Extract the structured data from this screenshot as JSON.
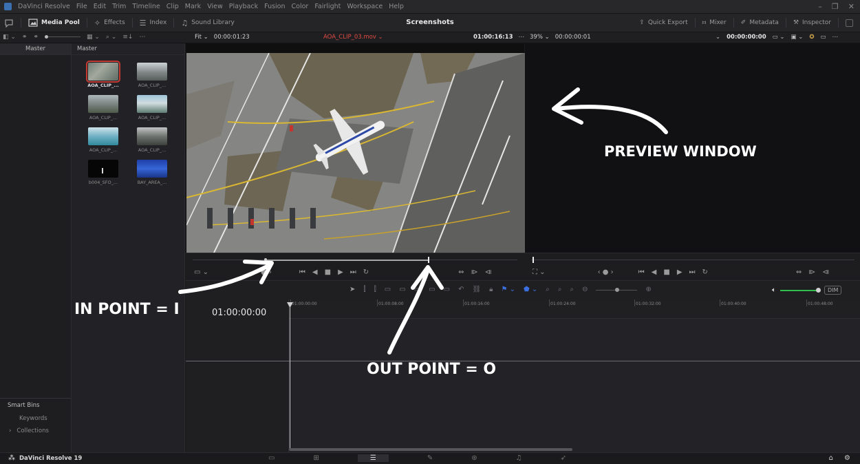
{
  "menubar": {
    "items": [
      "DaVinci Resolve",
      "File",
      "Edit",
      "Trim",
      "Timeline",
      "Clip",
      "Mark",
      "View",
      "Playback",
      "Fusion",
      "Color",
      "Fairlight",
      "Workspace",
      "Help"
    ]
  },
  "toolbar": {
    "media_pool": "Media Pool",
    "effects": "Effects",
    "index": "Index",
    "sound_library": "Sound Library",
    "project_title": "Screenshots",
    "quick_export": "Quick Export",
    "mixer": "Mixer",
    "metadata": "Metadata",
    "inspector": "Inspector"
  },
  "subbar": {
    "fit": "Fit",
    "src_duration": "00:00:01:23",
    "clip_name": "AOA_CLIP_03.mov",
    "src_timecode": "01:00:16:13",
    "zoom": "39%",
    "tl_duration": "00:00:00:01",
    "tl_timecode": "00:00:00:00"
  },
  "bins": {
    "header": "Master",
    "smart_bins": "Smart Bins",
    "keywords": "Keywords",
    "collections": "Collections"
  },
  "media": {
    "header": "Master",
    "clips": [
      "AOA_CLIP_...",
      "AOA_CLIP_...",
      "AOA_CLIP_...",
      "AOA_CLIP_...",
      "AOA_CLIP_...",
      "AOA_CLIP_...",
      "b004_SFO_...",
      "BAY_AREA_..."
    ]
  },
  "timeline": {
    "timecode": "01:00:00:00",
    "ticks": [
      "01:00:00:00",
      "01:00:08:00",
      "01:00:16:00",
      "01:00:24:00",
      "01:00:32:00",
      "01:00:40:00",
      "01:00:48:00"
    ],
    "dim": "DIM"
  },
  "bottombar": {
    "app_name": "DaVinci Resolve 19"
  },
  "annotations": {
    "preview": "PREVIEW WINDOW",
    "in_point": "IN POINT = I",
    "out_point": "OUT POINT = O"
  }
}
